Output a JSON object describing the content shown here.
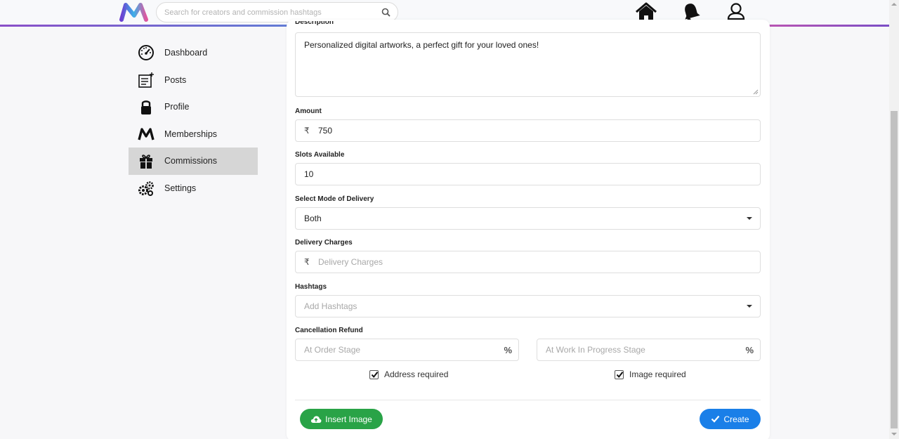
{
  "header": {
    "search_placeholder": "Search for creators and commission hashtags",
    "icons": [
      "logo-icon",
      "search-icon",
      "home-icon",
      "bell-icon",
      "user-icon"
    ]
  },
  "sidebar": {
    "items": [
      {
        "label": "Dashboard",
        "icon": "speedometer-icon"
      },
      {
        "label": "Posts",
        "icon": "posts-icon"
      },
      {
        "label": "Profile",
        "icon": "lock-icon"
      },
      {
        "label": "Memberships",
        "icon": "m-logo-icon"
      },
      {
        "label": "Commissions",
        "icon": "gift-icon",
        "active": true
      },
      {
        "label": "Settings",
        "icon": "gears-icon"
      }
    ]
  },
  "form": {
    "description_label": "Description",
    "description_value": "Personalized digital artworks, a perfect gift for your loved ones!",
    "amount_label": "Amount",
    "currency_symbol": "₹",
    "amount_value": "750",
    "slots_label": "Slots Available",
    "slots_value": "10",
    "delivery_mode_label": "Select Mode of Delivery",
    "delivery_mode_value": "Both",
    "delivery_charges_label": "Delivery Charges",
    "delivery_charges_placeholder": "Delivery Charges",
    "hashtags_label": "Hashtags",
    "hashtags_placeholder": "Add Hashtags",
    "refund_label": "Cancellation Refund",
    "order_stage_placeholder": "At Order Stage",
    "wip_stage_placeholder": "At Work In Progress Stage",
    "percent_symbol": "%",
    "address_required_label": "Address required",
    "address_required_checked": true,
    "image_required_label": "Image required",
    "image_required_checked": true
  },
  "actions": {
    "insert_image_label": "Insert Image",
    "create_label": "Create"
  },
  "colors": {
    "insert_button": "#29a347",
    "create_button": "#1a7fe8",
    "active_sidebar": "#d6d6d6"
  }
}
